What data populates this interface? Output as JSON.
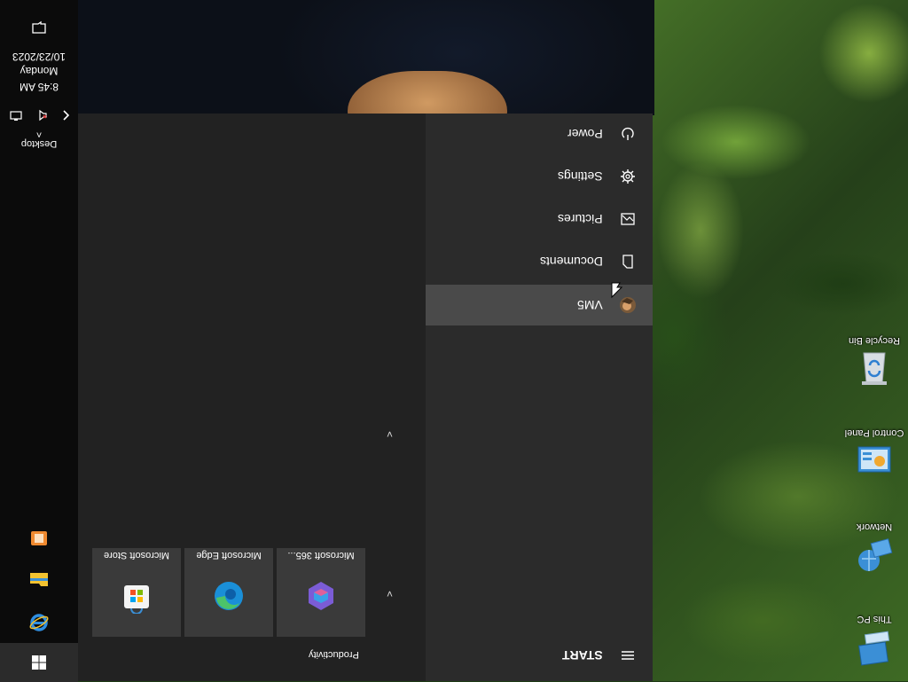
{
  "desktop": {
    "icons": [
      {
        "label": "Recycle Bin",
        "icon": "recycle-bin-icon"
      },
      {
        "label": "Control Panel",
        "icon": "control-panel-icon"
      },
      {
        "label": "Network",
        "icon": "network-icon"
      },
      {
        "label": "This PC",
        "icon": "this-pc-icon"
      }
    ]
  },
  "taskbar": {
    "start_icon": "windows-logo-icon",
    "pinned": [
      {
        "name": "Internet Explorer",
        "icon": "internet-explorer-icon"
      },
      {
        "name": "File Explorer",
        "icon": "file-explorer-icon"
      },
      {
        "name": "Media App",
        "icon": "media-app-icon"
      }
    ],
    "clock": {
      "time": "8:45 AM",
      "day": "Monday",
      "date": "10/23/2023"
    },
    "desktop_label": "Desktop",
    "notification_icon": "notification-icon"
  },
  "start_menu": {
    "rail": {
      "title": "START",
      "user": "VM5",
      "items": [
        {
          "label": "Documents",
          "icon": "document-icon"
        },
        {
          "label": "Pictures",
          "icon": "pictures-icon"
        },
        {
          "label": "Settings",
          "icon": "gear-icon"
        },
        {
          "label": "Power",
          "icon": "power-icon"
        }
      ]
    },
    "groups": [
      {
        "title": "Productivity",
        "tiles": [
          {
            "label": "Microsoft 365...",
            "icon": "microsoft-365-icon"
          },
          {
            "label": "Microsoft Edge",
            "icon": "edge-icon"
          },
          {
            "label": "Microsoft Store",
            "icon": "store-icon"
          }
        ]
      }
    ]
  },
  "colors": {
    "taskbar": "#0b0b0b",
    "start_bg": "#222222",
    "rail_bg": "#2b2b2b",
    "selected": "#4a4a4a",
    "tile_bg": "#3a3a3a"
  }
}
